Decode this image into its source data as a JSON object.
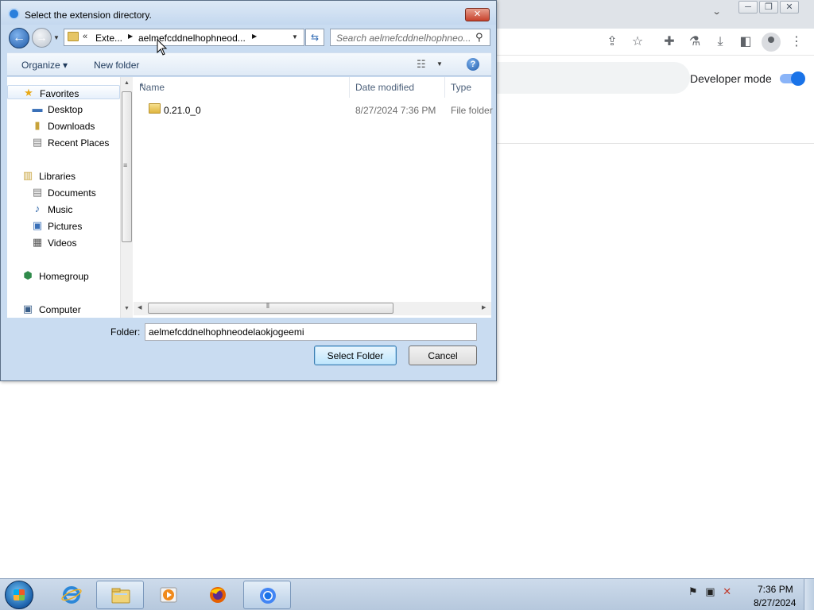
{
  "chrome": {
    "window_controls": [
      "─",
      "❐",
      "✕"
    ],
    "tab_dropdown": "⌄",
    "toolbar_icons": [
      "share-icon",
      "star-icon",
      "extensions-icon",
      "labs-icon",
      "download-icon",
      "sidepanel-icon",
      "profile-icon",
      "menu-icon"
    ],
    "developer_mode_label": "Developer mode",
    "developer_mode_on": true
  },
  "dialog": {
    "title": "Select the extension directory.",
    "close_glyph": "✕",
    "address": {
      "overflow": "«",
      "segments": [
        "Exte...",
        "aelmefcddnelhophneod..."
      ]
    },
    "search_placeholder": "Search aelmefcddnelhophneo...",
    "toolbar": {
      "organize_label": "Organize",
      "new_folder_label": "New folder",
      "help_glyph": "?"
    },
    "nav": {
      "favorites_label": "Favorites",
      "favorites": [
        "Desktop",
        "Downloads",
        "Recent Places"
      ],
      "libraries_label": "Libraries",
      "libraries": [
        "Documents",
        "Music",
        "Pictures",
        "Videos"
      ],
      "homegroup_label": "Homegroup",
      "computer_label": "Computer"
    },
    "columns": [
      "Name",
      "Date modified",
      "Type"
    ],
    "files": [
      {
        "name": "0.21.0_0",
        "date": "8/27/2024 7:36 PM",
        "type": "File folder"
      }
    ],
    "folder_label": "Folder:",
    "folder_value": "aelmefcddnelhophneodelaokjogeemi",
    "select_button": "Select Folder",
    "cancel_button": "Cancel"
  },
  "taskbar": {
    "apps": [
      "internet-explorer",
      "file-explorer",
      "media-player",
      "firefox",
      "chrome"
    ],
    "active_app": "chrome",
    "time": "7:36 PM",
    "date": "8/27/2024"
  },
  "colors": {
    "chrome_accent": "#1a73e8",
    "dialog_frame": "#c9dcf1",
    "close_red": "#c7412b"
  }
}
